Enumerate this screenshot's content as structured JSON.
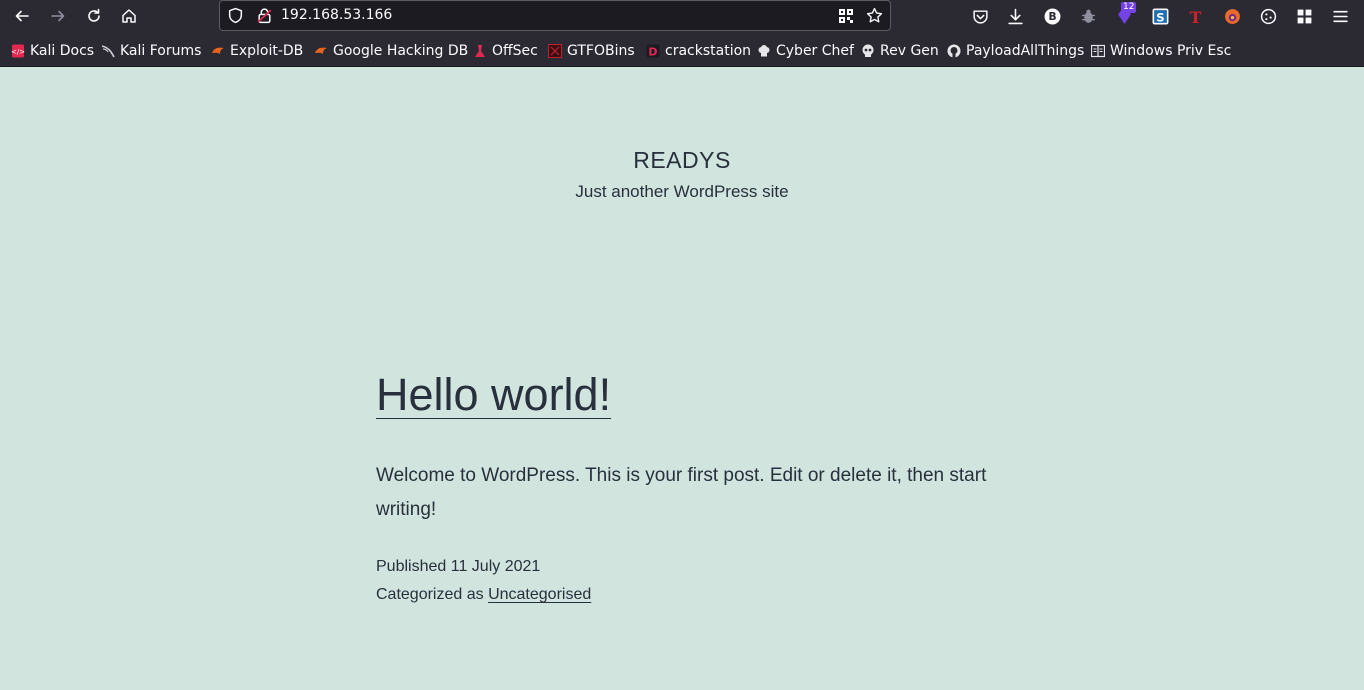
{
  "browser": {
    "url": "192.168.53.166",
    "extension_badge": "12",
    "bookmarks": [
      {
        "label": "Kali Docs",
        "icon": "kali-docs-icon"
      },
      {
        "label": "Kali Forums",
        "icon": "kali-dragon-icon"
      },
      {
        "label": "Exploit-DB",
        "icon": "exploit-db-icon"
      },
      {
        "label": "Google Hacking DB",
        "icon": "exploit-db-icon"
      },
      {
        "label": "OffSec",
        "icon": "offsec-icon"
      },
      {
        "label": "GTFOBins",
        "icon": "gtfobins-icon"
      },
      {
        "label": "crackstation",
        "icon": "crackstation-icon"
      },
      {
        "label": "Cyber Chef",
        "icon": "chef-hat-icon"
      },
      {
        "label": "Rev Gen",
        "icon": "skull-icon"
      },
      {
        "label": "PayloadAllThings",
        "icon": "github-icon"
      },
      {
        "label": "Windows Priv Esc",
        "icon": "book-icon"
      }
    ]
  },
  "site": {
    "title": "READYS",
    "description": "Just another WordPress site"
  },
  "post": {
    "title": "Hello world!",
    "body": "Welcome to WordPress. This is your first post. Edit or delete it, then start writing!",
    "published_prefix": "Published",
    "published_date": "11 July 2021",
    "category_prefix": "Categorized as",
    "category": "Uncategorised"
  }
}
